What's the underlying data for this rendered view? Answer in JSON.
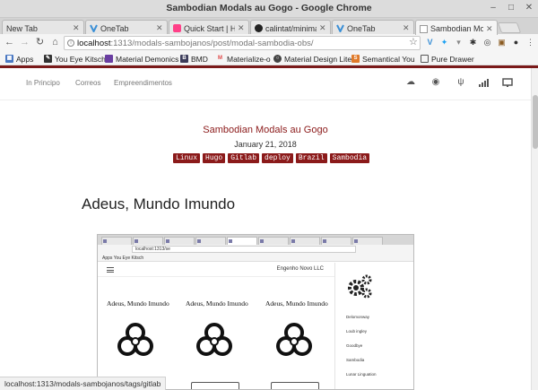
{
  "window": {
    "title": "Sambodian Modals au Gogo - Google Chrome"
  },
  "tabs": [
    {
      "label": "New Tab",
      "icon": "blank-page-icon",
      "active": false
    },
    {
      "label": "OneTab",
      "icon": "onetab-icon",
      "active": false
    },
    {
      "label": "Quick Start | Hug",
      "icon": "hugo-icon",
      "active": false
    },
    {
      "label": "calintat/minimal: ",
      "icon": "github-icon",
      "active": false
    },
    {
      "label": "OneTab",
      "icon": "onetab-icon",
      "active": false
    },
    {
      "label": "Sambodian Moda",
      "icon": "page-icon",
      "active": true
    }
  ],
  "address": {
    "host": "localhost",
    "path": ":1313/modals-sambojanos/post/modal-sambodia-obs/"
  },
  "bookmarks": [
    {
      "label": "Apps",
      "icon": "apps-grid-icon",
      "color": "#4a78c2"
    },
    {
      "label": "You Eye Kitsch",
      "icon": "you-eye-kitsch-icon",
      "color": "#333333"
    },
    {
      "label": "Material Demonics",
      "icon": "material-demonics-icon",
      "color": "#6a3ea1"
    },
    {
      "label": "BMD",
      "icon": "bmd-icon",
      "color": "#3c3c5a"
    },
    {
      "label": "Materialize-o",
      "icon": "materialize-icon",
      "color": "#e04848"
    },
    {
      "label": "Material Design Lite",
      "icon": "mdl-icon",
      "color": "#444444"
    },
    {
      "label": "Semantical You",
      "icon": "semantic-icon",
      "color": "#e07a2a"
    },
    {
      "label": "Pure Drawer",
      "icon": "pure-drawer-icon",
      "color": "#555555"
    }
  ],
  "sitenav": {
    "links": [
      "In Principo",
      "Correos",
      "Empreendimentos"
    ],
    "icons": [
      "chat-icon",
      "podcast-icon",
      "restaurant-icon",
      "signal-bars-icon",
      "monitor-icon"
    ]
  },
  "post": {
    "title": "Sambodian Modals au Gogo",
    "date": "January 21, 2018",
    "tags": [
      "Linux",
      "Hugo",
      "Gitlab",
      "deploy",
      "Brazil",
      "Sambodia"
    ],
    "heading": "Adeus, Mundo Imundo"
  },
  "embedded": {
    "url": "localhost:1313/se",
    "bookmarks": "Apps   You Eye Kitsch",
    "brand": "Engenho Novo LLC",
    "cards": [
      "Adeus, Mundo Imundo",
      "Adeus, Mundo Imundo",
      "Adeus, Mundo Imundo"
    ],
    "sidelinks": [
      "Delomonway",
      "Loub ingley",
      "Goodbye",
      "Sambodia",
      "Lunar Linguation"
    ]
  },
  "status": {
    "text": "localhost:1313/modals-sambojanos/tags/gitlab"
  },
  "colors": {
    "accent": "#8b1a1a",
    "tag_bg": "#8b1a1a"
  }
}
